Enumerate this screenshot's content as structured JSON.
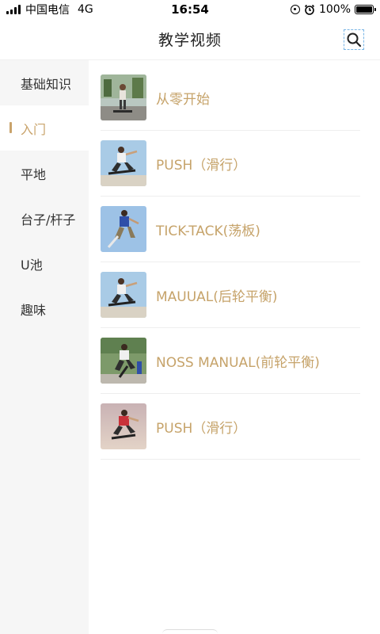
{
  "status_bar": {
    "carrier": "中国电信",
    "network": "4G",
    "time": "16:54",
    "battery": "100%"
  },
  "header": {
    "title": "教学视频",
    "search_icon": "search-icon"
  },
  "sidebar": {
    "items": [
      {
        "label": "基础知识",
        "active": false
      },
      {
        "label": "入门",
        "active": true
      },
      {
        "label": "平地",
        "active": false
      },
      {
        "label": "台子/杆子",
        "active": false
      },
      {
        "label": "U池",
        "active": false
      },
      {
        "label": "趣味",
        "active": false
      }
    ]
  },
  "videos": [
    {
      "title": "从零开始"
    },
    {
      "title": "PUSH（滑行）"
    },
    {
      "title": "TICK-TACK(荡板)"
    },
    {
      "title": "MAUUAL(后轮平衡)"
    },
    {
      "title": "NOSS MANUAL(前轮平衡)"
    },
    {
      "title": "PUSH（滑行）"
    }
  ],
  "colors": {
    "accent": "#c6a36a",
    "sidebar_bg": "#f6f6f6"
  }
}
